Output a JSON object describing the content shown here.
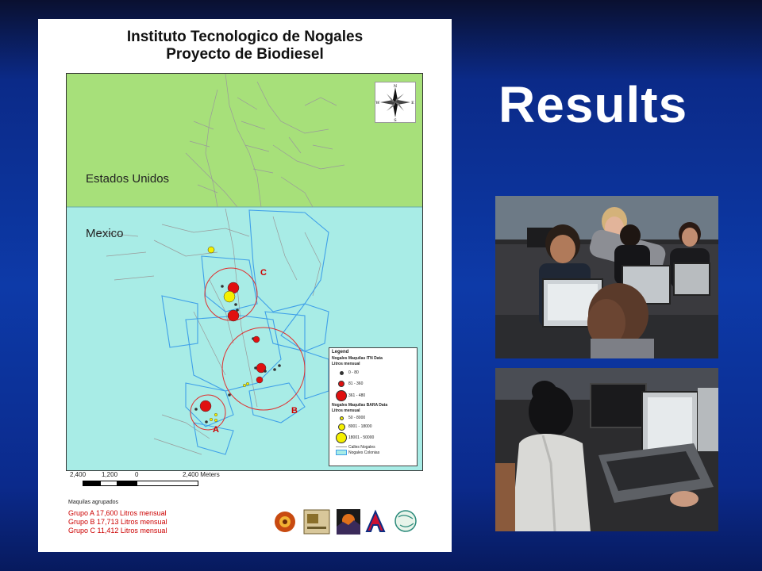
{
  "slide": {
    "title": "Results"
  },
  "map": {
    "title_line1": "Instituto Tecnologico de Nogales",
    "title_line2": "Proyecto de Biodiesel",
    "region_us": "Estados Unidos",
    "region_mx": "Mexico",
    "group_labels": [
      "A",
      "B",
      "C"
    ],
    "compass": {
      "n": "N",
      "s": "S",
      "e": "E",
      "w": "W"
    },
    "legend": {
      "title": "Legend",
      "itn_title": "Nogales Maquilas ITN Data",
      "itn_subtitle": "Litros mensual",
      "itn_items": [
        "0 - 80",
        "81 - 360",
        "361 - 480"
      ],
      "bara_title": "Nogales Maquilas BARA Data",
      "bara_subtitle": "Litros mensual",
      "bara_items": [
        "50 - 8000",
        "8001 - 18000",
        "18001 - 50000"
      ],
      "lines": [
        "Calles Nogales",
        "Nogales Colonias"
      ]
    },
    "scale": {
      "ticks": [
        "2,400",
        "1,200",
        "0",
        "2,400 Meters"
      ]
    },
    "footer": {
      "heading": "Maquilas agrupados",
      "groups": [
        "Grupo A 17,600 Litros mensual",
        "Grupo B 17,713 Litros mensual",
        "Grupo C 11,412 Litros mensual"
      ]
    },
    "colors": {
      "us_fill": "#a7e07a",
      "mx_fill": "#a8ece6",
      "colonias": "#3fa0e8",
      "streets": "#9a9a9a",
      "itn": "#e01010",
      "bara": "#f5f000",
      "group_circle": "#e03030"
    }
  },
  "photos": [
    {
      "name": "classroom-photo-top"
    },
    {
      "name": "classroom-photo-bottom"
    }
  ]
}
